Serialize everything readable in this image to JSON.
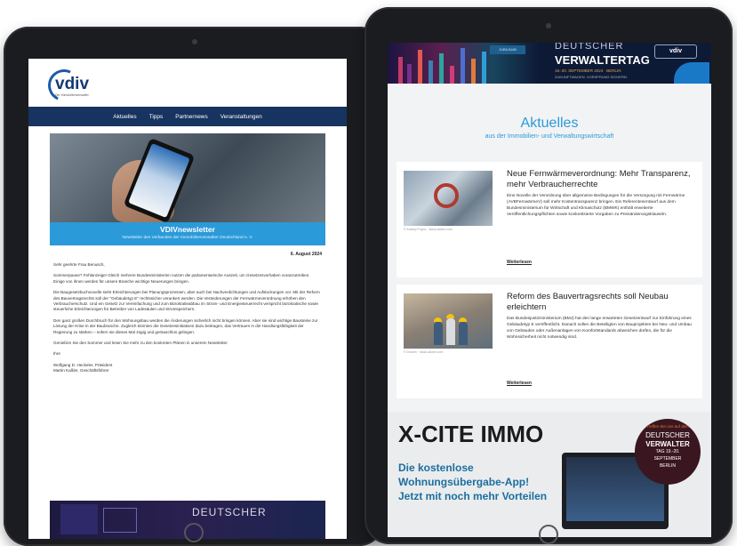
{
  "left_newsletter": {
    "logo_text": "vdiv",
    "logo_sub": "Der Immobilienverwalter",
    "nav": [
      "Aktuelles",
      "Tipps",
      "Partnernews",
      "Veranstaltungen"
    ],
    "hero_title": "VDIVnewsletter",
    "hero_subtitle": "Newsletter des Verbandes der Immobilienverwalter Deutschland e. V.",
    "date": "6. August 2024",
    "greeting": "Sehr geehrte Frau Benusch,",
    "paragraphs": [
      "Sommerpause? Fehlanzeige! Gleich mehrere Bundesministerien nutzen die parlamentarische Auszeit, um Gesetzesvorhaben voranzutreiben. Einige von ihnen werden für unsere Branche wichtige Neuerungen bringen.",
      "Die Baugesetzbuchnovelle sieht Erleichterungen bei Planungsprozessen, aber auch bei Nachverdichtungen und Aufstockungen vor. Mit der Reform des Bauvertragsrechts soll der \"Gebäudetyp E\" rechtssicher verankert werden. Die Veränderungen der Fernwärmeverordnung erhöhen den Verbraucherschutz. Und ein Gesetz zur Vereinfachung und zum Bürokratieabbau im Strom- und Energiesteuerrecht verspricht bürokratische sowie steuerliche Erleichterungen für Betreiber von Ladesäulen und Stromspeichern.",
      "Den ganz großen Durchbruch für den Wohnungsbau werden die Änderungen sicherlich nicht bringen können. Aber sie sind wichtige Bausteine zur Lösung der Krise in der Baubranche. Zugleich könnten die Gesetzesinitiativen dazu beitragen, das Vertrauen in die Handlungsfähigkeit der Regierung zu stärken – sofern sie dieses Mal zügig und geräuschlos gelingen.",
      "Genießen Sie den Sommer und lesen Sie mehr zu den konkreten Plänen in unserem Newsletter."
    ],
    "closing": "Ihre",
    "signers": [
      "Wolfgang D. Heckeler, Präsident",
      "Martin Kaßler, Geschäftsführer"
    ],
    "bottom_banner_text": "DEUTSCHER"
  },
  "right_newsletter": {
    "top_banner": {
      "chip": "JUBILÄUM",
      "title_line1": "DEUTSCHER",
      "title_line2": "VERWALTERTAG",
      "date": "19.-20. SEPTEMBER 2024 · BERLIN",
      "subline": "ZUKUNFTWAGEN. VORSPRUNG SICHERN.",
      "logo": "vdiv"
    },
    "section_title": "Aktuelles",
    "section_subtitle": "aus der Immobilien- und Verwaltungswirtschaft",
    "articles": [
      {
        "title": "Neue Fernwärmeverordnung: Mehr Transparenz, mehr Verbraucherrechte",
        "text": "Eine Novelle der Verordnung über allgemeine Bedingungen für die Versorgung mit Fernwärme (AVBFernwärmeV) soll mehr Kostentransparenz bringen. Ein Referentenentwurf aus dem Bundesministerium für Wirtschaft und Klimaschutz (BMWK) enthält erweiterte Veröffentlichungspflichten sowie konkretisierte Vorgaben zu Preisänderungsklauseln.",
        "caption": "© Andrey Popov · stock.adobe.com",
        "link": "Weiterlesen"
      },
      {
        "title": "Reform des Bauvertragsrechts soll Neubau erleichtern",
        "text": "Das Bundesjustizministerium (BMJ) hat den lange erwarteten Gesetzentwurf zur Einführung eines Gebäudetyp E veröffentlicht. Danach sollen die Beteiligten von Bauprojekten bei Neu- und Umbau von Gebäuden oder Außenanlagen von Komfortstandards abweichen dürfen, die für die Wohnsicherheit nicht notwendig sind.",
        "caption": "© Drazen · stock.adobe.com",
        "link": "Weiterlesen"
      }
    ],
    "ad": {
      "title": "X-CITE IMMO",
      "lines": [
        "Die kostenlose",
        "Wohnungsübergabe-App!",
        "Jetzt mit noch mehr Vorteilen"
      ],
      "badge": [
        "Treffen Sie uns auf dem",
        "DEUTSCHER",
        "VERWALTER",
        "TAG 19.-20.",
        "SEPTEMBER",
        "BERLIN"
      ]
    }
  },
  "colors": {
    "navy": "#17335f",
    "accent_blue": "#2b9ad9",
    "device": "#1b1c1f"
  }
}
